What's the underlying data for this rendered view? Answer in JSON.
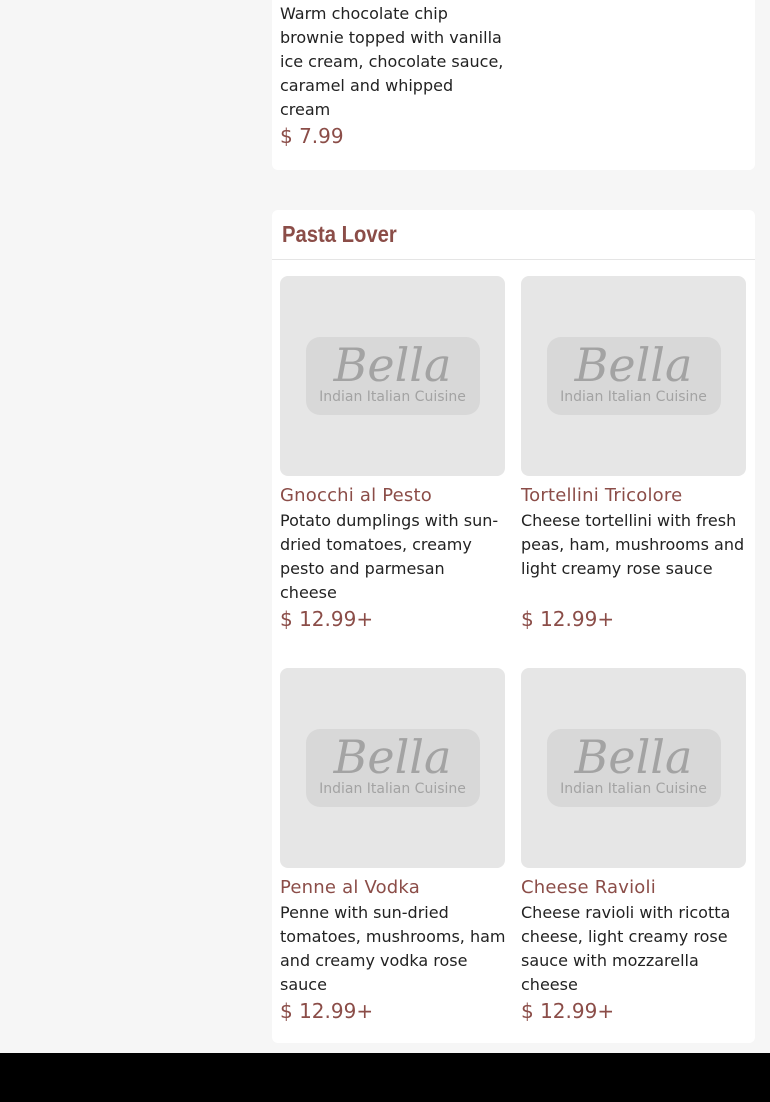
{
  "top_item": {
    "description": "Warm chocolate chip brownie topped with vanilla ice cream, chocolate sauce, caramel and whipped cream",
    "price": "$ 7.99"
  },
  "section": {
    "title": "Pasta Lover",
    "items": [
      {
        "name": "Gnocchi al Pesto",
        "description": "Potato dumplings with sun-dried tomatoes, creamy pesto and parmesan cheese",
        "price": "$ 12.99+"
      },
      {
        "name": "Tortellini Tricolore",
        "description": "Cheese tortellini with fresh peas, ham, mushrooms and light creamy rose sauce",
        "price": "$ 12.99+"
      },
      {
        "name": "Penne al Vodka",
        "description": "Penne with sun-dried tomatoes, mushrooms, ham and creamy vodka rose sauce",
        "price": "$ 12.99+"
      },
      {
        "name": "Cheese Ravioli",
        "description": "Cheese ravioli with ricotta cheese, light creamy rose sauce with mozzarella cheese",
        "price": "$ 12.99+"
      }
    ]
  },
  "placeholder_logo": {
    "name": "Bella",
    "tagline": "Indian Italian Cuisine"
  },
  "colors": {
    "accent": "#8b4d48",
    "page_background": "#f6f6f6",
    "card_background": "#ffffff",
    "footer_bar": "#000000"
  }
}
